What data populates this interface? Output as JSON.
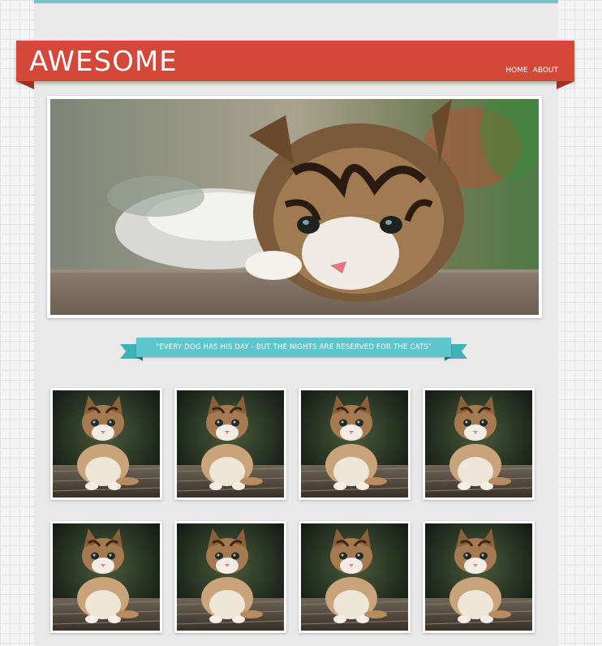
{
  "site": {
    "logo": "AWESOME",
    "nav": [
      {
        "label": "HOME"
      },
      {
        "label": "ABOUT"
      }
    ],
    "brand_color": "#d4483a",
    "accent_color": "#5cc6cc"
  },
  "hero": {
    "image": "kitten-hero-photo"
  },
  "quote": {
    "text": "\"EVERY DOG HAS HIS DAY - BUT THE NIGHTS ARE RESERVED FOR THE CATS\""
  },
  "gallery": {
    "items": [
      {
        "image": "kitten-photo"
      },
      {
        "image": "kitten-photo"
      },
      {
        "image": "kitten-photo"
      },
      {
        "image": "kitten-photo"
      },
      {
        "image": "kitten-photo"
      },
      {
        "image": "kitten-photo"
      },
      {
        "image": "kitten-photo"
      },
      {
        "image": "kitten-photo"
      }
    ]
  }
}
